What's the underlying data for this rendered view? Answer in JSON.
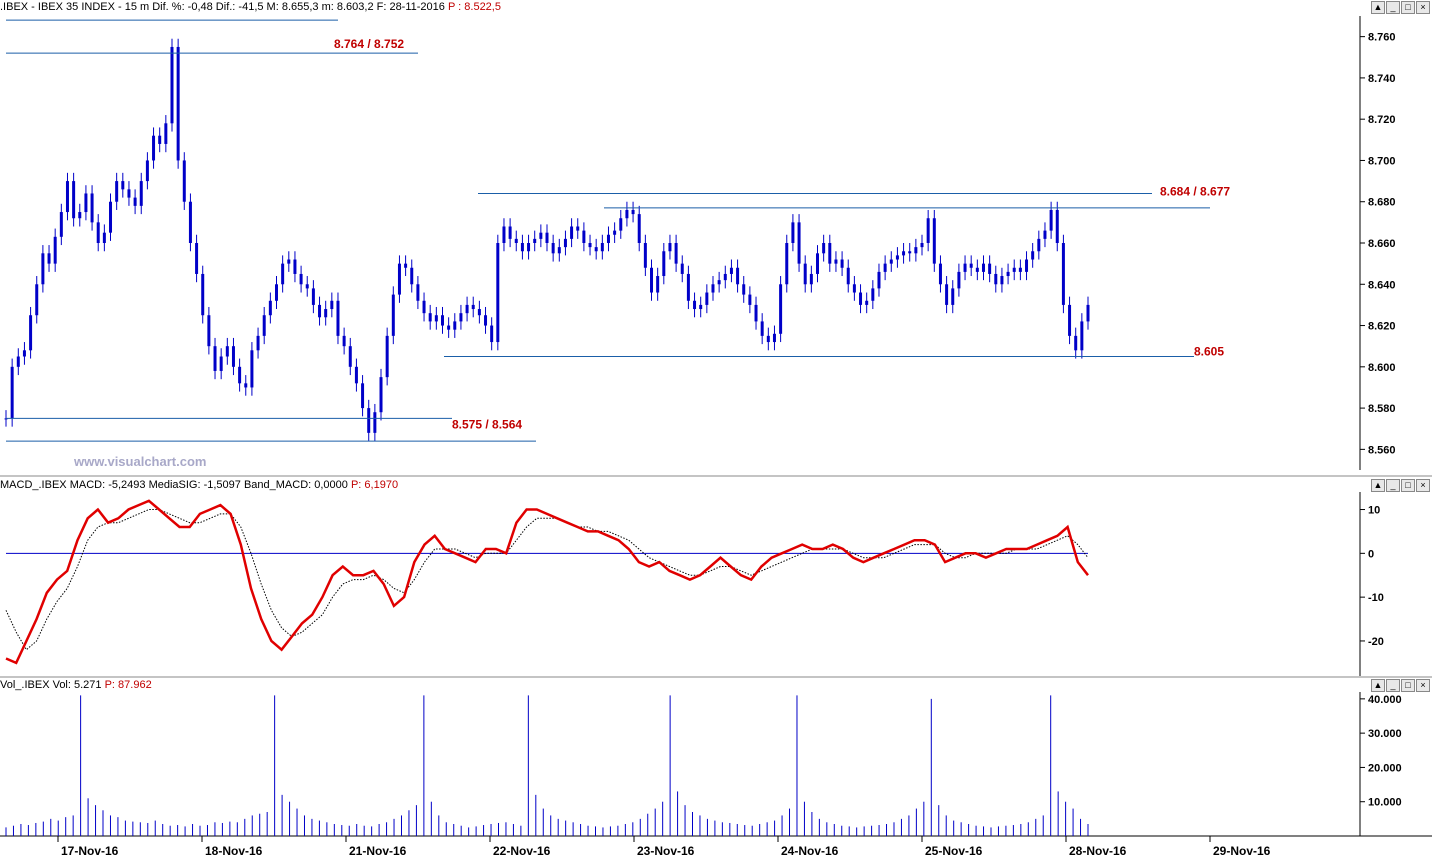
{
  "price_header": {
    "symbol": ".IBEX - IBEX 35 INDEX - 15 m",
    "fields": "Dif. %: -0,48  Dif.: -41,5  M: 8.655,3  m: 8.603,2  F: 28-11-2016",
    "last": "P : 8.522,5"
  },
  "macd_header": {
    "label": "MACD_.IBEX",
    "fields": "MACD: -5,2493  MediaSIG: -1,5097  Band_MACD: 0,0000",
    "last": "P: 6,1970"
  },
  "vol_header": {
    "label": "Vol_.IBEX Vol: 5.271",
    "last": "P: 87.962"
  },
  "watermark": "www.visualchart.com",
  "pane_buttons": [
    "▲",
    "_",
    "□",
    "×"
  ],
  "annotations": {
    "resistance_top": "8.764 / 8.752",
    "resistance_mid": "8.684 / 8.677",
    "support_mid": "8.605",
    "support_low": "8.575 / 8.564"
  },
  "colors": {
    "candle": "#0000c8",
    "macd": "#e00000",
    "signal": "#000000",
    "annotation": "#c00000",
    "trendline": "#1a5ea8"
  },
  "chart_data": [
    {
      "type": "candlestick",
      "title": "IBEX 35 INDEX - 15 m",
      "x": [
        "17-Nov-16",
        "18-Nov-16",
        "21-Nov-16",
        "22-Nov-16",
        "23-Nov-16",
        "24-Nov-16",
        "25-Nov-16",
        "28-Nov-16",
        "29-Nov-16"
      ],
      "y_ticks": [
        "8.760",
        "8.740",
        "8.720",
        "8.700",
        "8.680",
        "8.660",
        "8.640",
        "8.620",
        "8.600",
        "8.580",
        "8.560"
      ],
      "ylim": [
        8550,
        8770
      ],
      "close_series": [
        8575,
        8600,
        8605,
        8608,
        8625,
        8640,
        8655,
        8650,
        8663,
        8675,
        8690,
        8672,
        8675,
        8684,
        8670,
        8660,
        8665,
        8680,
        8690,
        8686,
        8682,
        8678,
        8690,
        8700,
        8712,
        8708,
        8718,
        8755,
        8700,
        8680,
        8660,
        8645,
        8625,
        8610,
        8598,
        8605,
        8610,
        8600,
        8592,
        8590,
        8608,
        8615,
        8625,
        8632,
        8640,
        8650,
        8652,
        8645,
        8640,
        8638,
        8630,
        8624,
        8628,
        8632,
        8615,
        8610,
        8600,
        8592,
        8580,
        8568,
        8578,
        8595,
        8615,
        8635,
        8650,
        8648,
        8640,
        8632,
        8626,
        8622,
        8625,
        8620,
        8618,
        8622,
        8626,
        8630,
        8628,
        8625,
        8620,
        8612,
        8660,
        8668,
        8662,
        8660,
        8656,
        8660,
        8662,
        8665,
        8660,
        8655,
        8658,
        8662,
        8668,
        8666,
        8660,
        8658,
        8656,
        8660,
        8664,
        8666,
        8672,
        8676,
        8674,
        8660,
        8648,
        8636,
        8644,
        8656,
        8660,
        8650,
        8645,
        8632,
        8628,
        8630,
        8636,
        8640,
        8642,
        8645,
        8648,
        8640,
        8635,
        8630,
        8622,
        8615,
        8612,
        8616,
        8640,
        8660,
        8670,
        8650,
        8640,
        8645,
        8655,
        8660,
        8650,
        8652,
        8648,
        8640,
        8636,
        8630,
        8632,
        8638,
        8646,
        8650,
        8652,
        8654,
        8656,
        8655,
        8658,
        8660,
        8672,
        8650,
        8640,
        8630,
        8638,
        8646,
        8650,
        8648,
        8646,
        8650,
        8645,
        8640,
        8644,
        8646,
        8648,
        8646,
        8652,
        8656,
        8662,
        8666,
        8676,
        8660,
        8630,
        8615,
        8608,
        8622,
        8630
      ]
    },
    {
      "type": "line",
      "title": "MACD_.IBEX",
      "y_ticks": [
        "10",
        "0",
        "-10",
        "-20"
      ],
      "ylim": [
        -28,
        14
      ],
      "series": [
        {
          "name": "MACD",
          "values": [
            -24,
            -25,
            -20,
            -15,
            -9,
            -6,
            -4,
            3,
            8,
            10,
            7,
            8,
            10,
            11,
            12,
            10,
            8,
            6,
            6,
            9,
            10,
            11,
            9,
            2,
            -8,
            -15,
            -20,
            -22,
            -19,
            -16,
            -14,
            -10,
            -5,
            -3,
            -5,
            -5,
            -4,
            -7,
            -12,
            -10,
            -2,
            2,
            4,
            1,
            0,
            -1,
            -2,
            1,
            1,
            0,
            7,
            10,
            10,
            9,
            8,
            7,
            6,
            5,
            5,
            4,
            3,
            1,
            -2,
            -3,
            -2,
            -4,
            -5,
            -6,
            -5,
            -3,
            -1,
            -3,
            -5,
            -6,
            -3,
            -1,
            0,
            1,
            2,
            1,
            1,
            2,
            1,
            -1,
            -2,
            -1,
            0,
            1,
            2,
            3,
            3,
            2,
            -2,
            -1,
            0,
            0,
            -1,
            0,
            1,
            1,
            1,
            2,
            3,
            4,
            6,
            -2,
            -5
          ]
        },
        {
          "name": "MediaSIG",
          "values": [
            -13,
            -18,
            -22,
            -20,
            -15,
            -11,
            -8,
            -3,
            3,
            6,
            7,
            7,
            8,
            9,
            10,
            10,
            9,
            8,
            7,
            7,
            8,
            9,
            9,
            6,
            0,
            -7,
            -13,
            -17,
            -19,
            -18,
            -16,
            -14,
            -10,
            -7,
            -6,
            -6,
            -5,
            -6,
            -8,
            -9,
            -6,
            -2,
            1,
            1,
            1,
            0,
            -1,
            0,
            0,
            0,
            3,
            6,
            8,
            8,
            8,
            7,
            6,
            6,
            5,
            5,
            4,
            3,
            1,
            -1,
            -2,
            -3,
            -4,
            -5,
            -5,
            -4,
            -3,
            -3,
            -4,
            -5,
            -4,
            -3,
            -2,
            -1,
            0,
            1,
            1,
            1,
            1,
            0,
            -1,
            -1,
            -1,
            0,
            1,
            2,
            2,
            2,
            0,
            -1,
            -1,
            0,
            0,
            0,
            0,
            1,
            1,
            1,
            2,
            3,
            4,
            2,
            -1
          ]
        }
      ]
    },
    {
      "type": "bar",
      "title": "Vol_.IBEX",
      "y_ticks": [
        "40.000",
        "30.000",
        "20.000",
        "10.000"
      ],
      "ylim": [
        0,
        42000
      ],
      "values": [
        2500,
        3000,
        3500,
        3200,
        3800,
        4200,
        5000,
        4500,
        5500,
        6000,
        41000,
        11000,
        9000,
        7500,
        6000,
        5500,
        4500,
        4200,
        4000,
        3800,
        4500,
        3500,
        3000,
        3200,
        2800,
        3500,
        3000,
        3200,
        4000,
        3800,
        4200,
        4000,
        5000,
        6000,
        6500,
        7000,
        41000,
        12000,
        10000,
        8000,
        6000,
        5000,
        4500,
        4000,
        3500,
        3200,
        3000,
        3500,
        3000,
        2800,
        3500,
        4000,
        5000,
        6000,
        7500,
        9000,
        41000,
        10000,
        6000,
        4000,
        3500,
        3000,
        2500,
        2800,
        3200,
        3500,
        3800,
        4000,
        3500,
        3000,
        41000,
        12000,
        8000,
        6000,
        5000,
        4500,
        4000,
        3500,
        3000,
        2800,
        2500,
        2800,
        3000,
        3500,
        4000,
        5000,
        6500,
        8000,
        10000,
        41000,
        13000,
        9000,
        7000,
        6000,
        5000,
        4500,
        4000,
        3800,
        3500,
        3200,
        3000,
        3500,
        4000,
        4500,
        6000,
        8000,
        41000,
        10000,
        7000,
        5000,
        4000,
        3500,
        3000,
        2800,
        2500,
        2800,
        3000,
        3200,
        3500,
        4000,
        5000,
        6000,
        8000,
        10000,
        40000,
        9000,
        6000,
        4500,
        4000,
        3500,
        3000,
        2800,
        2500,
        2800,
        3000,
        3200,
        3500,
        4000,
        5000,
        6000,
        41000,
        13000,
        10000,
        8000,
        5000,
        3500
      ]
    }
  ]
}
